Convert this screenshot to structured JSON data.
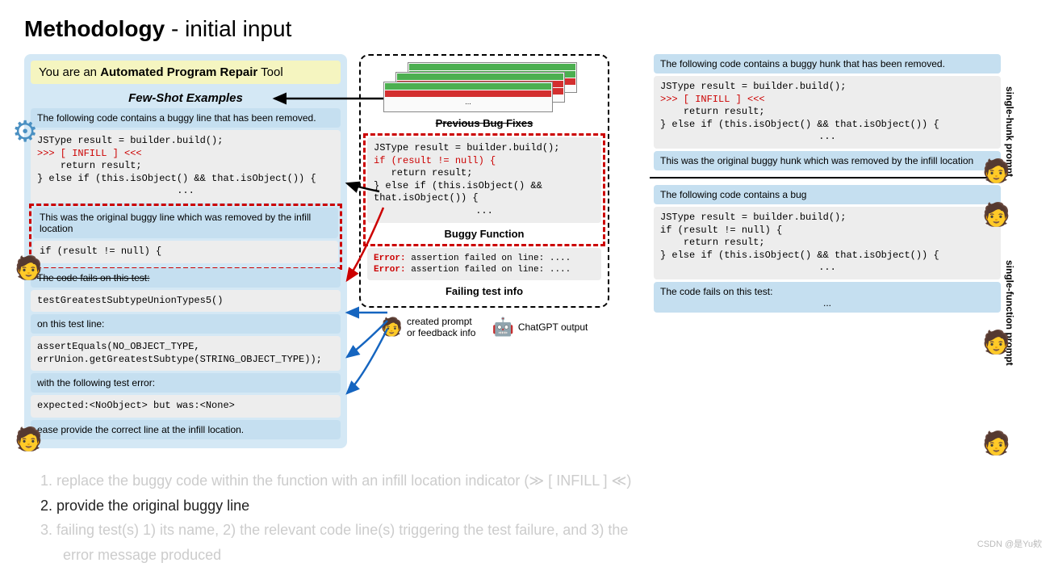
{
  "title_bold": "Methodology",
  "title_rest": " - initial input",
  "left": {
    "banner_pre": "You are an ",
    "banner_bold": "Automated Program Repair",
    "banner_post": " Tool",
    "few_shot": "Few-Shot Examples",
    "intro": "The following code contains a buggy line that has been removed.",
    "code1_l1": "JSType result = builder.build();",
    "code1_infill": ">>> [ INFILL ] <<<",
    "code1_l2": "    return result;",
    "code1_l3": "} else if (this.isObject() && that.isObject()) {",
    "code1_ell": "...",
    "buggy_intro": "This was the original buggy line which was removed by the infill location",
    "buggy_code": "if (result != null) {",
    "fails_on": "The code fails on this test:",
    "test_name": "testGreatestSubtypeUnionTypes5()",
    "on_line": "on this test line:",
    "assert_l1": "assertEquals(NO_OBJECT_TYPE,",
    "assert_l2": "errUnion.getGreatestSubtype(STRING_OBJECT_TYPE));",
    "with_err": "with the following test error:",
    "err_msg": "expected:<NoObject> but was:<None>",
    "please": "ease provide the correct line at the infill location."
  },
  "mid": {
    "prev_fixes": "Previous Bug Fixes",
    "code_l1": "JSType result = builder.build();",
    "code_l2": "if (result != null) {",
    "code_l3": "   return result;",
    "code_l4": "} else if (this.isObject() &&",
    "code_l5": "that.isObject()) {",
    "code_ell": "...",
    "buggy_fn": "Buggy Function",
    "err1_label": "Error:",
    "err1": " assertion failed on line: ....",
    "err2_label": "Error:",
    "err2": " assertion failed on line: ....",
    "failing_test": "Failing test info",
    "legend_prompt": "created prompt\nor feedback info",
    "legend_gpt": "ChatGPT output"
  },
  "right": {
    "sh_intro": "The following code contains a buggy hunk that has been removed.",
    "sh_c1": "JSType result = builder.build();",
    "sh_infill": ">>> [ INFILL ] <<<",
    "sh_c2": "    return result;",
    "sh_c3": "} else if (this.isObject() && that.isObject()) {",
    "sh_ell": "...",
    "sh_buggy": "This was the original buggy hunk which was removed by the infill location",
    "sh_label": "single-hunk prompt",
    "sf_intro": "The following code contains a bug",
    "sf_c1": "JSType result = builder.build();",
    "sf_c2": "if (result != null) {",
    "sf_c3": "    return result;",
    "sf_c4": "} else if (this.isObject() && that.isObject()) {",
    "sf_ell": "...",
    "sf_fails": "The code fails on this test:",
    "sf_fails_ell": "...",
    "sf_label": "single-function prompt"
  },
  "steps": {
    "s1": "1.  replace the buggy code within the function with an infill location indicator (≫ [ INFILL ] ≪)",
    "s2": "2.  provide the original buggy line",
    "s3a": "3.  failing test(s) 1) its name, 2) the relevant code line(s) triggering the test failure, and 3) the",
    "s3b": "error message produced"
  },
  "watermark": "CSDN @是Yu欸"
}
